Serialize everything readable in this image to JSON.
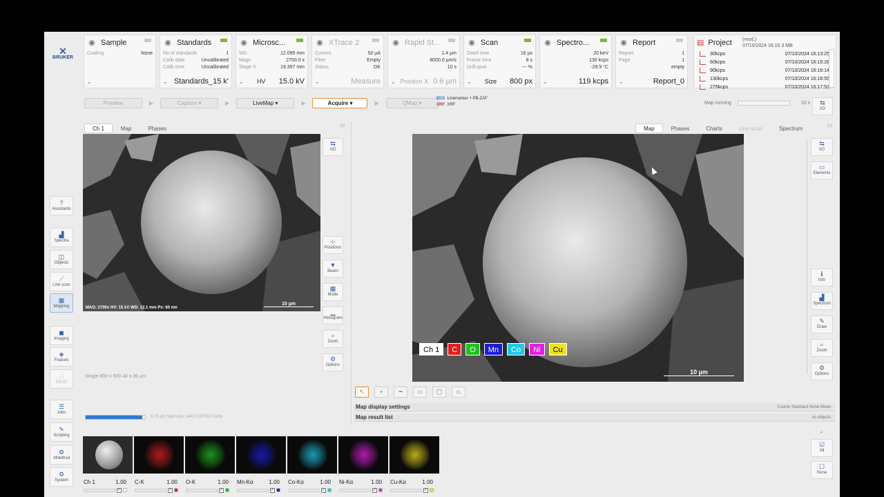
{
  "logo": "BRUKER",
  "panels": [
    {
      "id": "sample",
      "title": "Sample",
      "icon": "sample-icon",
      "rows": [
        [
          "Coating",
          "None"
        ]
      ],
      "footer": "",
      "dim": false,
      "led": false
    },
    {
      "id": "standards",
      "title": "Standards",
      "icon": "standards-icon",
      "rows": [
        [
          "No of standards",
          "1"
        ],
        [
          "Calib date",
          "Uncalibrated"
        ],
        [
          "Calib time",
          "Uncalibrated"
        ]
      ],
      "footer": "Standards_15 k'",
      "dim": false,
      "led": true
    },
    {
      "id": "microscope",
      "title": "Microsc...",
      "icon": "microscope-icon",
      "rows": [
        [
          "WD",
          "12.095 mm"
        ],
        [
          "Magn",
          "2700.0 x"
        ],
        [
          "Stage X",
          "19.397 mm"
        ]
      ],
      "footer_label": "HV",
      "footer": "15.0 kV",
      "dim": false,
      "led": true
    },
    {
      "id": "xtrace",
      "title": "XTrace 2",
      "icon": "xtrace-icon",
      "rows": [
        [
          "Current",
          "50 µA"
        ],
        [
          "Filter",
          "Empty"
        ],
        [
          "Status",
          "OK"
        ]
      ],
      "footer": "Measure",
      "dim": true,
      "led": false
    },
    {
      "id": "rapidstage",
      "title": "Rapid St...",
      "icon": "rapid-stage-icon",
      "rows": [
        [
          "",
          "1.4 µm"
        ],
        [
          "",
          "8000.0 µm/s"
        ],
        [
          "",
          "10 s"
        ]
      ],
      "footer_label": "Position X",
      "footer": "0.6 µm",
      "dim": true,
      "led": false
    },
    {
      "id": "scan",
      "title": "Scan",
      "icon": "scan-icon",
      "rows": [
        [
          "Dwell time",
          "16 µs"
        ],
        [
          "Frame time",
          "8 s"
        ],
        [
          "Drift qual",
          "--- %"
        ]
      ],
      "footer_label": "Size",
      "footer": "800 px",
      "dim": false,
      "led": true
    },
    {
      "id": "spectro",
      "title": "Spectro...",
      "icon": "spectrometer-icon",
      "rows": [
        [
          "",
          "20 keV"
        ],
        [
          "",
          "130 kcps"
        ],
        [
          "",
          "-29.9 °C"
        ]
      ],
      "footer": "119 kcps",
      "dim": false,
      "led": true
    },
    {
      "id": "report",
      "title": "Report",
      "icon": "report-icon",
      "rows": [
        [
          "Report",
          "1"
        ],
        [
          "Page",
          "1"
        ],
        [
          "",
          "empty"
        ]
      ],
      "footer": "Report_0",
      "dim": false,
      "led": false
    }
  ],
  "project": {
    "title": "Project",
    "meta1": "(mod.)",
    "meta2": "07/10/2024 16:15   3 MB",
    "items": [
      [
        "30kcps",
        "07/10/2024 16:13:25"
      ],
      [
        "60kcps",
        "07/10/2024 16:15:28"
      ],
      [
        "90kcps",
        "07/10/2024 16:16:14"
      ],
      [
        "130kcps",
        "07/10/2024 16:16:55"
      ],
      [
        "275kcps",
        "07/10/2024 16:17:53"
      ]
    ]
  },
  "toolbar": {
    "preview": "Preview",
    "capture": "Capture",
    "livemap": "LiveMap",
    "acquire": "Acquire",
    "qmap": "QMap"
  },
  "eds": {
    "line1": "EDS",
    "line1b": "Linemarker + PB-ZAF",
    "line2": "XRF",
    "line2b": "XRF"
  },
  "map_running": {
    "label": "Map running",
    "time": "10 s"
  },
  "left_sidebar": [
    "Assistants",
    "Spectra",
    "Objects",
    "Line scan",
    "Mapping",
    "Imaging",
    "Feature",
    "EBSD",
    "Jobs",
    "Scripting",
    "XMethod",
    "System"
  ],
  "tabs_left": [
    "Ch 1",
    "Map",
    "Phases"
  ],
  "tabs_right": [
    "Map",
    "Phases",
    "Charts",
    "Line scan",
    "Spectrum"
  ],
  "io_label": "I/O",
  "left_tools": [
    "I/O",
    "Positions",
    "Beam",
    "Mode",
    "Histogram",
    "Zoom",
    "Options"
  ],
  "right_tools_top": [
    "I/O",
    "Elements"
  ],
  "right_tools_mid": [
    "Info",
    "Spectrum",
    "Draw",
    "Zoom",
    "Options"
  ],
  "sem_overlay": "MAG: 2700x   HV: 15 kV   WD: 12.1 mm   Px: 60 nm",
  "scale": "10 µm",
  "chips": [
    {
      "t": "Ch 1",
      "c": "#ffffff",
      "fg": "#000000"
    },
    {
      "t": "C",
      "c": "#e02020",
      "fg": "#ffffff"
    },
    {
      "t": "O",
      "c": "#20c020",
      "fg": "#ffffff"
    },
    {
      "t": "Mn",
      "c": "#1c1cd8",
      "fg": "#ffffff"
    },
    {
      "t": "Co",
      "c": "#20c8e8",
      "fg": "#ffffff"
    },
    {
      "t": "Ni",
      "c": "#e020e0",
      "fg": "#ffffff"
    },
    {
      "t": "Cu",
      "c": "#f0e020",
      "fg": "#000000"
    }
  ],
  "single": "Single      800 x 600   48 x 36 µm",
  "progress": 0.95,
  "spot": "0.75 µm Spot size   14407x10792 Points",
  "accord1": {
    "title": "Map display settings",
    "right": "Counts   Standard   None   Mean"
  },
  "accord2": {
    "title": "Map result list",
    "right": "no objects"
  },
  "thumbs": [
    {
      "n": "Ch 1",
      "v": "1.00",
      "c": "#ffffff"
    },
    {
      "n": "C-K",
      "v": "1.00",
      "c": "#e02020"
    },
    {
      "n": "O-K",
      "v": "1.00",
      "c": "#20c020"
    },
    {
      "n": "Mn-Kα",
      "v": "1.00",
      "c": "#1c1cd8"
    },
    {
      "n": "Co-Kα",
      "v": "1.00",
      "c": "#20c8e8"
    },
    {
      "n": "Ni-Kα",
      "v": "1.00",
      "c": "#e020e0"
    },
    {
      "n": "Cu-Kα",
      "v": "1.00",
      "c": "#f0e020"
    }
  ],
  "bottom_right": [
    "All",
    "None"
  ]
}
